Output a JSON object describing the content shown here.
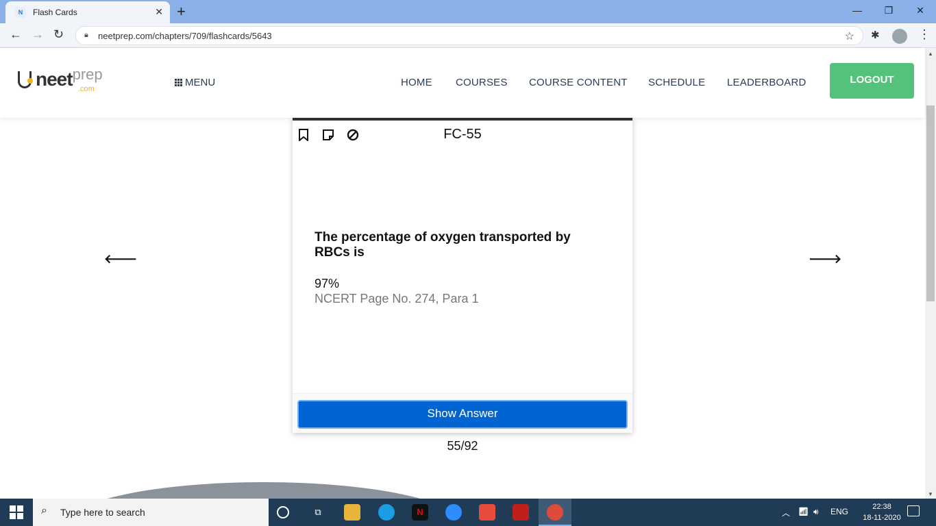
{
  "browser": {
    "tab_title": "Flash Cards",
    "tab_close": "✕",
    "new_tab": "+",
    "url": "neetprep.com/chapters/709/flashcards/5643",
    "window_buttons": [
      "—",
      "❐",
      "✕"
    ]
  },
  "site": {
    "logo_main": "neet",
    "logo_prep": "prep",
    "logo_com": ".com",
    "menu_label": "MENU",
    "nav": [
      "HOME",
      "COURSES",
      "COURSE CONTENT",
      "SCHEDULE",
      "LEADERBOARD"
    ],
    "logout_label": "LOGOUT"
  },
  "flashcard": {
    "id": "FC-55",
    "question": "The percentage of oxygen transported by RBCs is",
    "answer": "97%",
    "reference": "NCERT Page No. 274, Para 1",
    "show_answer_label": "Show Answer",
    "counter": "55/92",
    "prev_arrow": "🡐",
    "next_arrow": "🡒"
  },
  "taskbar": {
    "search_placeholder": "Type here to search",
    "language": "ENG",
    "time": "22:38",
    "date": "18-11-2020"
  },
  "colors": {
    "logout": "#54c27a",
    "show_answer": "#0064d2",
    "tabbar": "#8ab0e8",
    "taskbar": "#1f3b55"
  }
}
